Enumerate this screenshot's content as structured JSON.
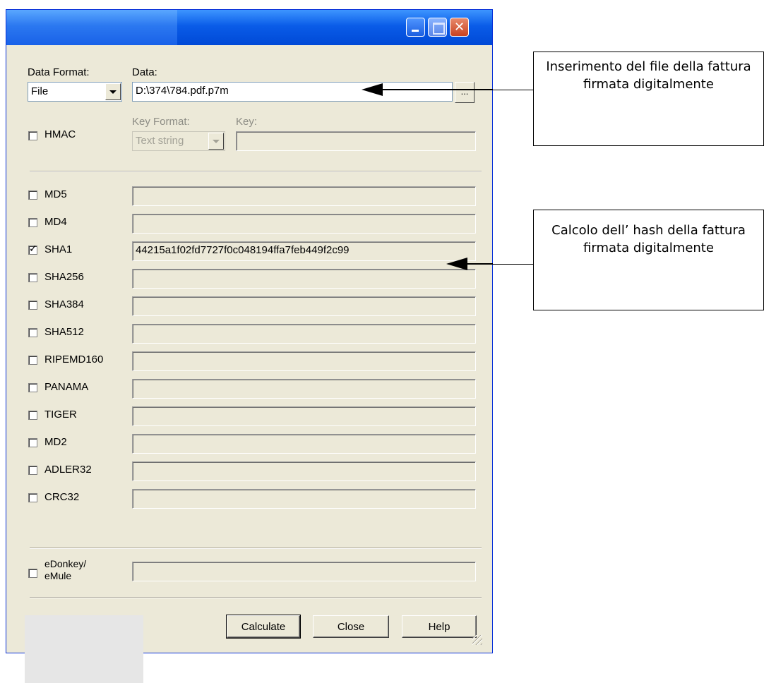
{
  "window": {
    "title": "",
    "buttons": {
      "minimize": "minimize",
      "maximize": "maximize",
      "close": "close"
    }
  },
  "data_section": {
    "format_label": "Data Format:",
    "format_value": "File",
    "data_label": "Data:",
    "data_value": "D:\\374\\784.pdf.p7m",
    "browse_label": "..."
  },
  "hmac": {
    "label": "HMAC",
    "checked": false,
    "key_format_label": "Key Format:",
    "key_format_value": "Text string",
    "key_label": "Key:",
    "key_value": ""
  },
  "hashes": [
    {
      "label": "MD5",
      "checked": false,
      "value": ""
    },
    {
      "label": "MD4",
      "checked": false,
      "value": ""
    },
    {
      "label": "SHA1",
      "checked": true,
      "value": "44215a1f02fd7727f0c048194ffa7feb449f2c99"
    },
    {
      "label": "SHA256",
      "checked": false,
      "value": ""
    },
    {
      "label": "SHA384",
      "checked": false,
      "value": ""
    },
    {
      "label": "SHA512",
      "checked": false,
      "value": ""
    },
    {
      "label": "RIPEMD160",
      "checked": false,
      "value": ""
    },
    {
      "label": "PANAMA",
      "checked": false,
      "value": ""
    },
    {
      "label": "TIGER",
      "checked": false,
      "value": ""
    },
    {
      "label": "MD2",
      "checked": false,
      "value": ""
    },
    {
      "label": "ADLER32",
      "checked": false,
      "value": ""
    },
    {
      "label": "CRC32",
      "checked": false,
      "value": ""
    }
  ],
  "edonkey": {
    "label_line1": "eDonkey/",
    "label_line2": "eMule",
    "checked": false,
    "value": ""
  },
  "buttons": {
    "calculate": "Calculate",
    "close": "Close",
    "help": "Help"
  },
  "callouts": {
    "file_input": "Inserimento del file della fattura firmata digitalmente",
    "hash_calc": "Calcolo dell’ hash della fattura firmata digitalmente"
  }
}
